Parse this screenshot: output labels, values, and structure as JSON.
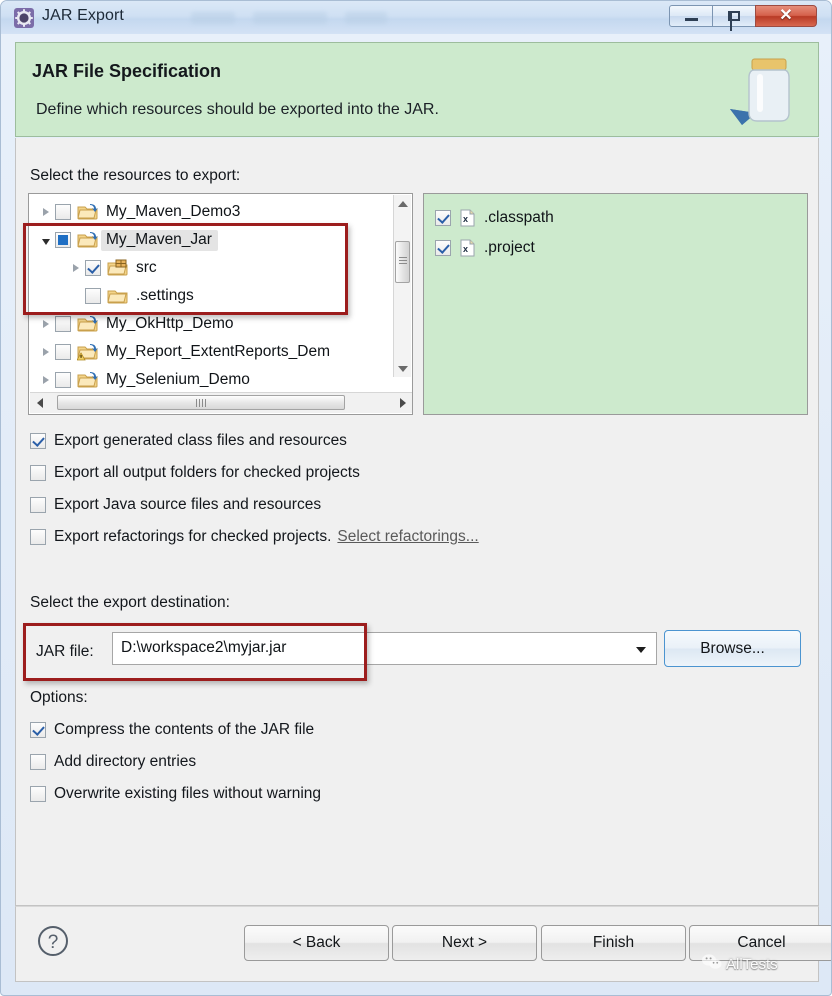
{
  "window": {
    "title": "JAR Export",
    "icon": "eclipse-wizard-icon",
    "minimize_label": "Minimize",
    "maximize_label": "Maximize",
    "close_label": "Close"
  },
  "header": {
    "title": "JAR File Specification",
    "subtitle": "Define which resources should be exported into the JAR.",
    "banner_color": "#CDEACD",
    "icon": "jar-banner-icon"
  },
  "resources": {
    "label": "Select the resources to export:",
    "tree": [
      {
        "name": "My_Maven_Demo3",
        "indent": 0,
        "twisty": "right",
        "checkbox": "unchecked",
        "icon": "project-folder-icon",
        "selected": false
      },
      {
        "name": "My_Maven_Jar",
        "indent": 0,
        "twisty": "down",
        "checkbox": "filled",
        "icon": "project-folder-icon",
        "selected": true
      },
      {
        "name": "src",
        "indent": 1,
        "twisty": "right",
        "checkbox": "checked",
        "icon": "source-package-icon",
        "selected": false
      },
      {
        "name": ".settings",
        "indent": 1,
        "twisty": "none",
        "checkbox": "unchecked",
        "icon": "folder-icon",
        "selected": false
      },
      {
        "name": "My_OkHttp_Demo",
        "indent": 0,
        "twisty": "right",
        "checkbox": "unchecked",
        "icon": "project-folder-icon",
        "selected": false
      },
      {
        "name": "My_Report_ExtentReports_Dem",
        "indent": 0,
        "twisty": "right",
        "checkbox": "unchecked",
        "icon": "project-folder-warning-icon",
        "selected": false
      },
      {
        "name": "My_Selenium_Demo",
        "indent": 0,
        "twisty": "right",
        "checkbox": "unchecked",
        "icon": "project-folder-icon",
        "selected": false
      }
    ],
    "files": [
      {
        "name": ".classpath",
        "checkbox": "checked",
        "icon": "xml-file-icon"
      },
      {
        "name": ".project",
        "checkbox": "checked",
        "icon": "xml-file-icon"
      }
    ],
    "file_panel_color": "#CDEACD"
  },
  "export_options": [
    {
      "label": "Export generated class files and resources",
      "checked": true
    },
    {
      "label": "Export all output folders for checked projects",
      "checked": false
    },
    {
      "label": "Export Java source files and resources",
      "checked": false
    },
    {
      "label": "Export refactorings for checked projects.",
      "checked": false,
      "link": "Select refactorings..."
    }
  ],
  "destination": {
    "label": "Select the export destination:",
    "jar_file_label": "JAR file:",
    "jar_file_value": "D:\\workspace2\\myjar.jar",
    "browse_label": "Browse..."
  },
  "options": {
    "label": "Options:",
    "items": [
      {
        "label": "Compress the contents of the JAR file",
        "checked": true
      },
      {
        "label": "Add directory entries",
        "checked": false
      },
      {
        "label": "Overwrite existing files without warning",
        "checked": false
      }
    ]
  },
  "footer": {
    "help_icon": "help-question-icon",
    "buttons": [
      {
        "label": "< Back",
        "name": "back"
      },
      {
        "label": "Next >",
        "name": "next"
      },
      {
        "label": "Finish",
        "name": "finish"
      },
      {
        "label": "Cancel",
        "name": "cancel"
      }
    ]
  },
  "watermark": {
    "text": "AllTests",
    "icon": "wechat-logo-icon"
  },
  "colors": {
    "highlight_red": "#9C1D1B",
    "banner_green": "#CDEACD",
    "accent_blue": "#4B94D0"
  }
}
